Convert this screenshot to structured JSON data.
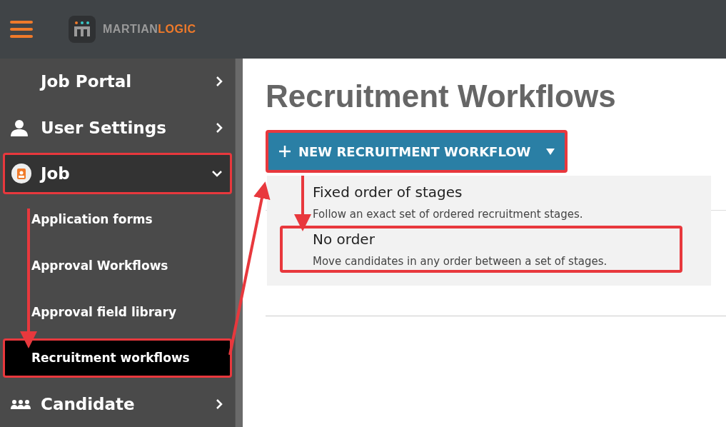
{
  "header": {
    "brand_primary": "MARTIAN",
    "brand_accent": "LOGIC"
  },
  "sidebar": {
    "items": [
      {
        "kind": "plain",
        "label": "Job Portal",
        "expanded": false,
        "highlighted": false
      },
      {
        "kind": "user",
        "label": "User Settings",
        "expanded": false,
        "highlighted": false
      },
      {
        "kind": "job",
        "label": "Job",
        "expanded": true,
        "highlighted": true,
        "children": [
          {
            "label": "Application forms",
            "selected": false,
            "highlighted": false
          },
          {
            "label": "Approval Workflows",
            "selected": false,
            "highlighted": false
          },
          {
            "label": "Approval field library",
            "selected": false,
            "highlighted": false
          },
          {
            "label": "Recruitment workflows",
            "selected": true,
            "highlighted": true
          }
        ]
      },
      {
        "kind": "group",
        "label": "Candidate",
        "expanded": false,
        "highlighted": false
      }
    ]
  },
  "main": {
    "title": "Recruitment Workflows",
    "new_button": {
      "label": "NEW RECRUITMENT WORKFLOW",
      "highlighted": true
    },
    "dropdown": [
      {
        "title": "Fixed order of stages",
        "description": "Follow an exact set of ordered recruitment stages.",
        "highlighted": false
      },
      {
        "title": "No order",
        "description": "Move candidates in any order between a set of stages.",
        "highlighted": true
      }
    ]
  }
}
